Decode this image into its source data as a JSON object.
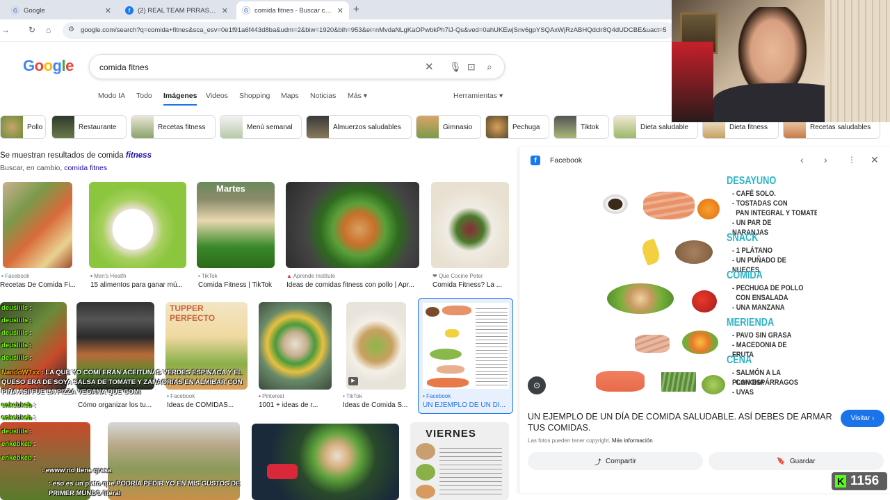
{
  "browser": {
    "tabs": [
      {
        "title": "Google",
        "icon": "google-icon"
      },
      {
        "title": "(2) REAL TEAM PRRAS! | Facebook",
        "icon": "facebook-icon"
      },
      {
        "title": "comida fitnes - Buscar con Google",
        "icon": "google-icon"
      }
    ],
    "url": "google.com/search?q=comida+fitnes&sca_esv=0e1f91a6f443d8ba&udm=2&biw=1920&bih=953&ei=nMvdaNLgKaOPwbkPh7iJ-Qs&ved=0ahUKEwjSnv6gpYSQAxWjRzABHQdclr8Q4dUDCBE&uact=5"
  },
  "google": {
    "logo": "Google",
    "query": "comida fitnes",
    "nav": [
      "Modo IA",
      "Todo",
      "Imágenes",
      "Videos",
      "Shopping",
      "Maps",
      "Noticias",
      "Más ▾",
      "Herramientas ▾"
    ],
    "chips": [
      "Pollo",
      "Restaurante",
      "Recetas fitness",
      "Menú semanal",
      "Almuerzos saludables",
      "Gimnasio",
      "Pechuga",
      "Tiktok",
      "Dieta saludable",
      "Dieta fitness",
      "Recetas saludables"
    ],
    "results_prefix": "Se muestran resultados de comida ",
    "results_term": "fitness",
    "instead_prefix": "Buscar, en cambio, ",
    "instead_term": "comida fitnes"
  },
  "row1": [
    {
      "source": "Facebook",
      "title": "Recetas De Comida Fi..."
    },
    {
      "source": "Men's Health",
      "title": "15 alimentos para ganar mú..."
    },
    {
      "source": "TikTok",
      "title": "Comida Fitness | TikTok"
    },
    {
      "source": "Aprende Institute",
      "title": "Ideas de comidas fitness con pollo | Apr..."
    },
    {
      "source": "Que Cocine Peter",
      "title": "Comida Fitness? La ..."
    }
  ],
  "row2": [
    {
      "source": "",
      "title": "Cómo organizar los tu..."
    },
    {
      "source": "Facebook",
      "title": "Ideas de COMIDAS..."
    },
    {
      "source": "Pinterest",
      "title": "1001 + ideas de r..."
    },
    {
      "source": "TikTok",
      "title": "Ideas de Comida S..."
    },
    {
      "source": "Facebook",
      "title": "UN EJEMPLO DE UN DÍ..."
    }
  ],
  "thumb_text": {
    "martes": "Martes",
    "tupper": "TUPPER PERFECTO",
    "viernes": "VIERNES"
  },
  "panel": {
    "source": "Facebook",
    "title": "UN EJEMPLO DE UN DÍA DE COMIDA SALUDABLE. ASÍ DEBES DE ARMAR TUS COMIDAS.",
    "visit": "Visitar ›",
    "copyright": "Las fotos pueden tener copyright.",
    "more_info": "Más información",
    "share": "Compartir",
    "save": "Guardar",
    "diet": [
      {
        "heading": "DESAYUNO",
        "lines": [
          "- CAFÉ SOLO.",
          "- TOSTADAS CON",
          "  PAN INTEGRAL Y TOMATE",
          "- UN PAR DE NARANJAS"
        ]
      },
      {
        "heading": "SNACK",
        "lines": [
          "- 1 PLÁTANO",
          "- UN PUÑADO DE NUECES"
        ]
      },
      {
        "heading": "COMIDA",
        "lines": [
          "- PECHUGA DE POLLO",
          "  CON ENSALADA",
          "- UNA MANZANA"
        ]
      },
      {
        "heading": "MERIENDA",
        "lines": [
          "- PAVO SIN GRASA",
          "- MACEDONIA DE FRUTA"
        ]
      },
      {
        "heading": "CENA",
        "lines": [
          "- SALMÓN A LA PLANCHA",
          "  CON ESPÁRRAGOS",
          "- UVAS"
        ]
      }
    ]
  },
  "chat": [
    {
      "user": "deusliils",
      "msg": ":"
    },
    {
      "user": "deusliils",
      "msg": ":"
    },
    {
      "user": "deusliils",
      "msg": ":"
    },
    {
      "user": "deusliils",
      "msg": ":"
    },
    {
      "user": "deusliils",
      "msg": ":"
    },
    {
      "user": "NandoWTxx",
      "msg": ": LA QUE YO COMI ERAN ACEITUNAS VERDES ESPINACA Y EL QUESO ERA DE SOYA SALSA DE TOMATE Y ZANAORIAS EN ALMIBAR CON PIÑA ASI FUE LA PIZZA VEGANA QUE COMI"
    },
    {
      "user": "enkebkeb",
      "msg": ":"
    },
    {
      "user": "enkebkeb",
      "msg": ":"
    },
    {
      "user": "deusliils",
      "msg": ":"
    },
    {
      "user": "enkebkeb",
      "msg": ":"
    },
    {
      "user": "enkebkeb",
      "msg": ":"
    },
    {
      "user": "",
      "msg": ": ewww no tiene grasa"
    },
    {
      "user": "",
      "msg": ": eso es un plato que PODRIA PEDIR YO EN MIS GUSTOS DE PRIMER MUNDO literal"
    }
  ],
  "counter": {
    "value": "1156",
    "icon": "K"
  }
}
